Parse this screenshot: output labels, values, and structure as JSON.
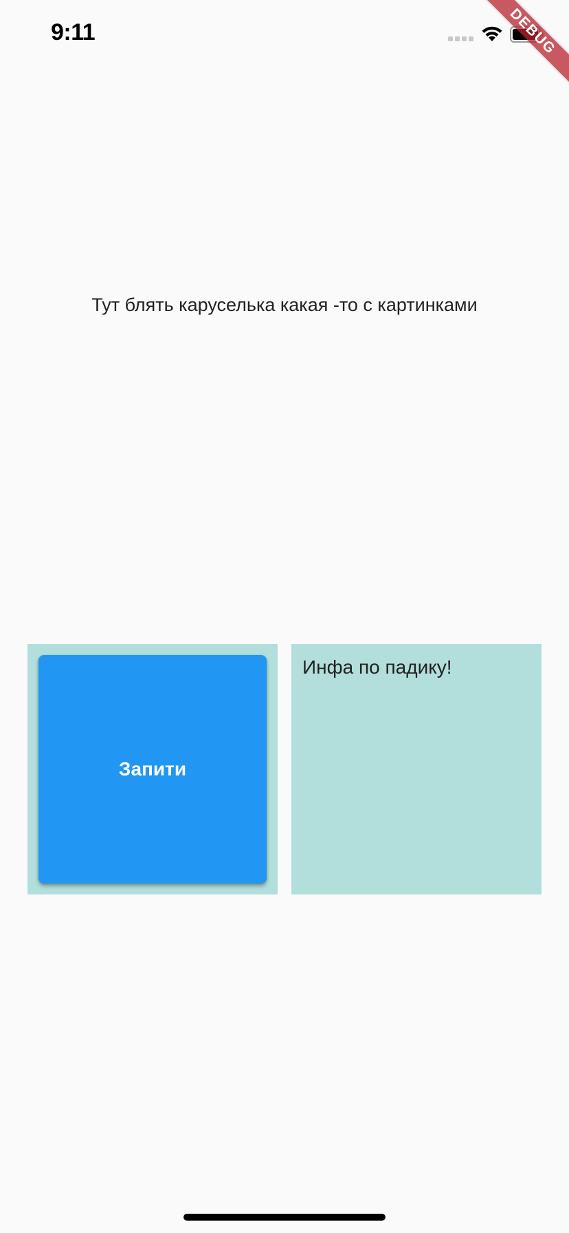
{
  "status_bar": {
    "time": "9:11",
    "wifi_icon": "wifi-icon",
    "battery_icon": "battery-icon"
  },
  "debug_banner": {
    "label": "DEBUG",
    "color": "#b7212d"
  },
  "carousel": {
    "placeholder_text": "Тут блять каруселька какая -то с картинками"
  },
  "tiles": {
    "query_button_label": "Запити",
    "info_text": "Инфа по падику!"
  },
  "colors": {
    "tile_background": "#b2dfdb",
    "button_primary": "#2196f3",
    "page_background": "#fafafa"
  }
}
